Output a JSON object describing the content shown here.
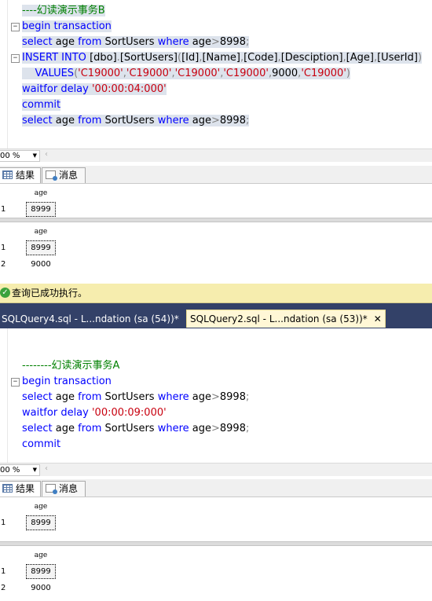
{
  "top_editor": {
    "lines": [
      {
        "parts": [
          {
            "t": "----幻读演示事务B",
            "c": "cmt"
          }
        ],
        "hl": true
      },
      {
        "parts": [
          {
            "t": "begin transaction",
            "c": "kw"
          }
        ],
        "hl": true,
        "fold": true
      },
      {
        "parts": [
          {
            "t": "select ",
            "c": "kw"
          },
          {
            "t": "age ",
            "c": ""
          },
          {
            "t": "from ",
            "c": "kw"
          },
          {
            "t": "SortUsers ",
            "c": ""
          },
          {
            "t": "where ",
            "c": "kw"
          },
          {
            "t": "age",
            "c": ""
          },
          {
            "t": ">",
            "c": "gray"
          },
          {
            "t": "8998",
            "c": ""
          },
          {
            "t": ";",
            "c": "gray"
          }
        ],
        "hl": true
      },
      {
        "parts": [
          {
            "t": "INSERT INTO ",
            "c": "kw"
          },
          {
            "t": "[dbo]",
            "c": ""
          },
          {
            "t": ".",
            "c": "gray"
          },
          {
            "t": "[SortUsers]",
            "c": ""
          },
          {
            "t": "(",
            "c": "gray"
          },
          {
            "t": "[Id]",
            "c": ""
          },
          {
            "t": ",",
            "c": "gray"
          },
          {
            "t": "[Name]",
            "c": ""
          },
          {
            "t": ",",
            "c": "gray"
          },
          {
            "t": "[Code]",
            "c": ""
          },
          {
            "t": ",",
            "c": "gray"
          },
          {
            "t": "[Desciption]",
            "c": ""
          },
          {
            "t": ",",
            "c": "gray"
          },
          {
            "t": "[Age]",
            "c": ""
          },
          {
            "t": ",",
            "c": "gray"
          },
          {
            "t": "[UserId]",
            "c": ""
          },
          {
            "t": ")",
            "c": "gray"
          }
        ],
        "hl": true,
        "fold": true
      },
      {
        "parts": [
          {
            "t": "    VALUES",
            "c": "kw"
          },
          {
            "t": "(",
            "c": "gray"
          },
          {
            "t": "'C19000'",
            "c": "str"
          },
          {
            "t": ",",
            "c": "gray"
          },
          {
            "t": "'C19000'",
            "c": "str"
          },
          {
            "t": ",",
            "c": "gray"
          },
          {
            "t": "'C19000'",
            "c": "str"
          },
          {
            "t": ",",
            "c": "gray"
          },
          {
            "t": "'C19000'",
            "c": "str"
          },
          {
            "t": ",",
            "c": "gray"
          },
          {
            "t": "9000",
            "c": ""
          },
          {
            "t": ",",
            "c": "gray"
          },
          {
            "t": "'C19000'",
            "c": "str"
          },
          {
            "t": ")",
            "c": "gray"
          }
        ],
        "hl": true
      },
      {
        "parts": [
          {
            "t": "waitfor delay ",
            "c": "kw"
          },
          {
            "t": "'00:00:04:000'",
            "c": "str"
          }
        ],
        "hl": true
      },
      {
        "parts": [
          {
            "t": "commit",
            "c": "kw"
          }
        ],
        "hl": true
      },
      {
        "parts": [
          {
            "t": "select ",
            "c": "kw"
          },
          {
            "t": "age ",
            "c": ""
          },
          {
            "t": "from ",
            "c": "kw"
          },
          {
            "t": "SortUsers ",
            "c": ""
          },
          {
            "t": "where ",
            "c": "kw"
          },
          {
            "t": "age",
            "c": ""
          },
          {
            "t": ">",
            "c": "gray"
          },
          {
            "t": "8998",
            "c": ""
          },
          {
            "t": ";",
            "c": "gray"
          }
        ],
        "hl": true
      }
    ]
  },
  "top_zoom": "00 %",
  "result_tabs": {
    "results": "结果",
    "messages": "消息"
  },
  "top_results": [
    {
      "header": "age",
      "rows": [
        {
          "n": "1",
          "v": "8999",
          "sel": true
        }
      ]
    },
    {
      "header": "age",
      "rows": [
        {
          "n": "1",
          "v": "8999",
          "sel": true
        },
        {
          "n": "2",
          "v": "9000",
          "sel": false
        }
      ]
    }
  ],
  "status_text": "查询已成功执行。",
  "doc_tabs": [
    {
      "label": "SQLQuery4.sql - L...ndation (sa (54))*",
      "active": false
    },
    {
      "label": "SQLQuery2.sql - L...ndation (sa (53))*",
      "active": true,
      "close": "✕"
    }
  ],
  "bottom_editor": {
    "lines": [
      {
        "parts": [],
        "hl": false
      },
      {
        "parts": [
          {
            "t": "--------幻读演示事务A",
            "c": "cmt"
          }
        ],
        "hl": false
      },
      {
        "parts": [
          {
            "t": "begin transaction",
            "c": "kw"
          }
        ],
        "hl": false,
        "fold": true
      },
      {
        "parts": [
          {
            "t": "select ",
            "c": "kw"
          },
          {
            "t": "age ",
            "c": ""
          },
          {
            "t": "from ",
            "c": "kw"
          },
          {
            "t": "SortUsers ",
            "c": ""
          },
          {
            "t": "where ",
            "c": "kw"
          },
          {
            "t": "age",
            "c": ""
          },
          {
            "t": ">",
            "c": "gray"
          },
          {
            "t": "8998",
            "c": ""
          },
          {
            "t": ";",
            "c": "gray"
          }
        ],
        "hl": false
      },
      {
        "parts": [
          {
            "t": "waitfor delay ",
            "c": "kw"
          },
          {
            "t": "'00:00:09:000'",
            "c": "str"
          }
        ],
        "hl": false
      },
      {
        "parts": [
          {
            "t": "select ",
            "c": "kw"
          },
          {
            "t": "age ",
            "c": ""
          },
          {
            "t": "from ",
            "c": "kw"
          },
          {
            "t": "SortUsers ",
            "c": ""
          },
          {
            "t": "where ",
            "c": "kw"
          },
          {
            "t": "age",
            "c": ""
          },
          {
            "t": ">",
            "c": "gray"
          },
          {
            "t": "8998",
            "c": ""
          },
          {
            "t": ";",
            "c": "gray"
          }
        ],
        "hl": false
      },
      {
        "parts": [
          {
            "t": "commit",
            "c": "kw"
          }
        ],
        "hl": false
      }
    ]
  },
  "bottom_zoom": "00 %",
  "bottom_results": [
    {
      "header": "age",
      "rows": [
        {
          "n": "1",
          "v": "8999",
          "sel": true
        }
      ]
    },
    {
      "header": "age",
      "rows": [
        {
          "n": "1",
          "v": "8999",
          "sel": true
        },
        {
          "n": "2",
          "v": "9000",
          "sel": false
        }
      ]
    }
  ]
}
